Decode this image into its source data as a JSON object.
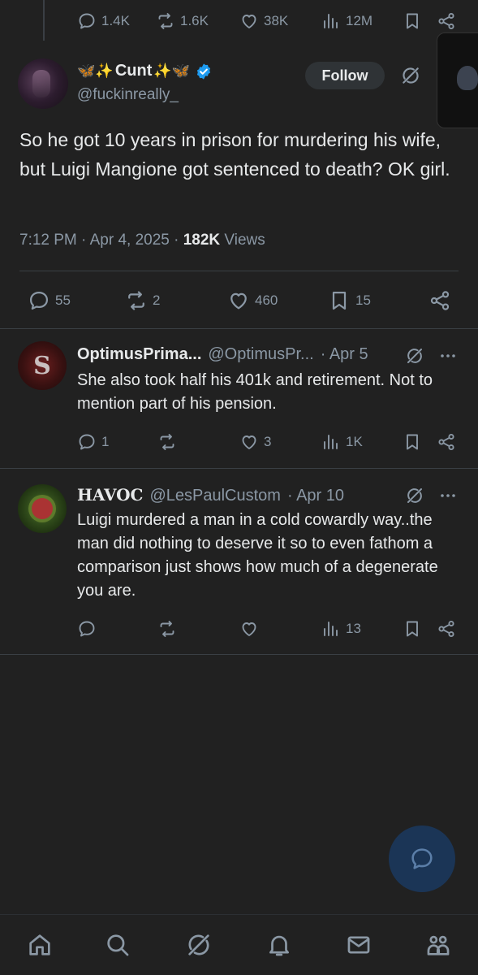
{
  "top_actions": {
    "replies": "1.4K",
    "reposts": "1.6K",
    "likes": "38K",
    "views": "12M"
  },
  "main_tweet": {
    "display_name": "Cunt",
    "name_emoji_left": "🦋✨",
    "name_emoji_right": "✨🦋",
    "handle": "@fuckinreally_",
    "follow_label": "Follow",
    "text": "So he got 10 years in prison for murdering his wife, but Luigi Mangione got sentenced to death? OK girl.",
    "time": "7:12 PM · Apr 4, 2025 · ",
    "views_count": "182K",
    "views_label": " Views",
    "stats": {
      "replies": "55",
      "reposts": "2",
      "likes": "460",
      "bookmarks": "15"
    }
  },
  "replies": [
    {
      "name": "OptimusPrima...",
      "handle": "@OptimusPr...",
      "date": "· Apr 5",
      "text": "She also took half his 401k and retirement.  Not to mention part of his pension.",
      "replies": "1",
      "reposts": "",
      "likes": "3",
      "views": "1K"
    },
    {
      "name": "HAVOC",
      "handle": "@LesPaulCustom",
      "date": "· Apr 10",
      "text": "Luigi murdered a man in a cold cowardly way..the man did nothing to deserve it so to even fathom a comparison just shows how much of a degenerate you are.",
      "replies": "",
      "reposts": "",
      "likes": "",
      "views": "13"
    }
  ],
  "icons": {
    "verified_color": "#1d9bf0",
    "fab_color": "#1b3556",
    "background": "#212121"
  }
}
